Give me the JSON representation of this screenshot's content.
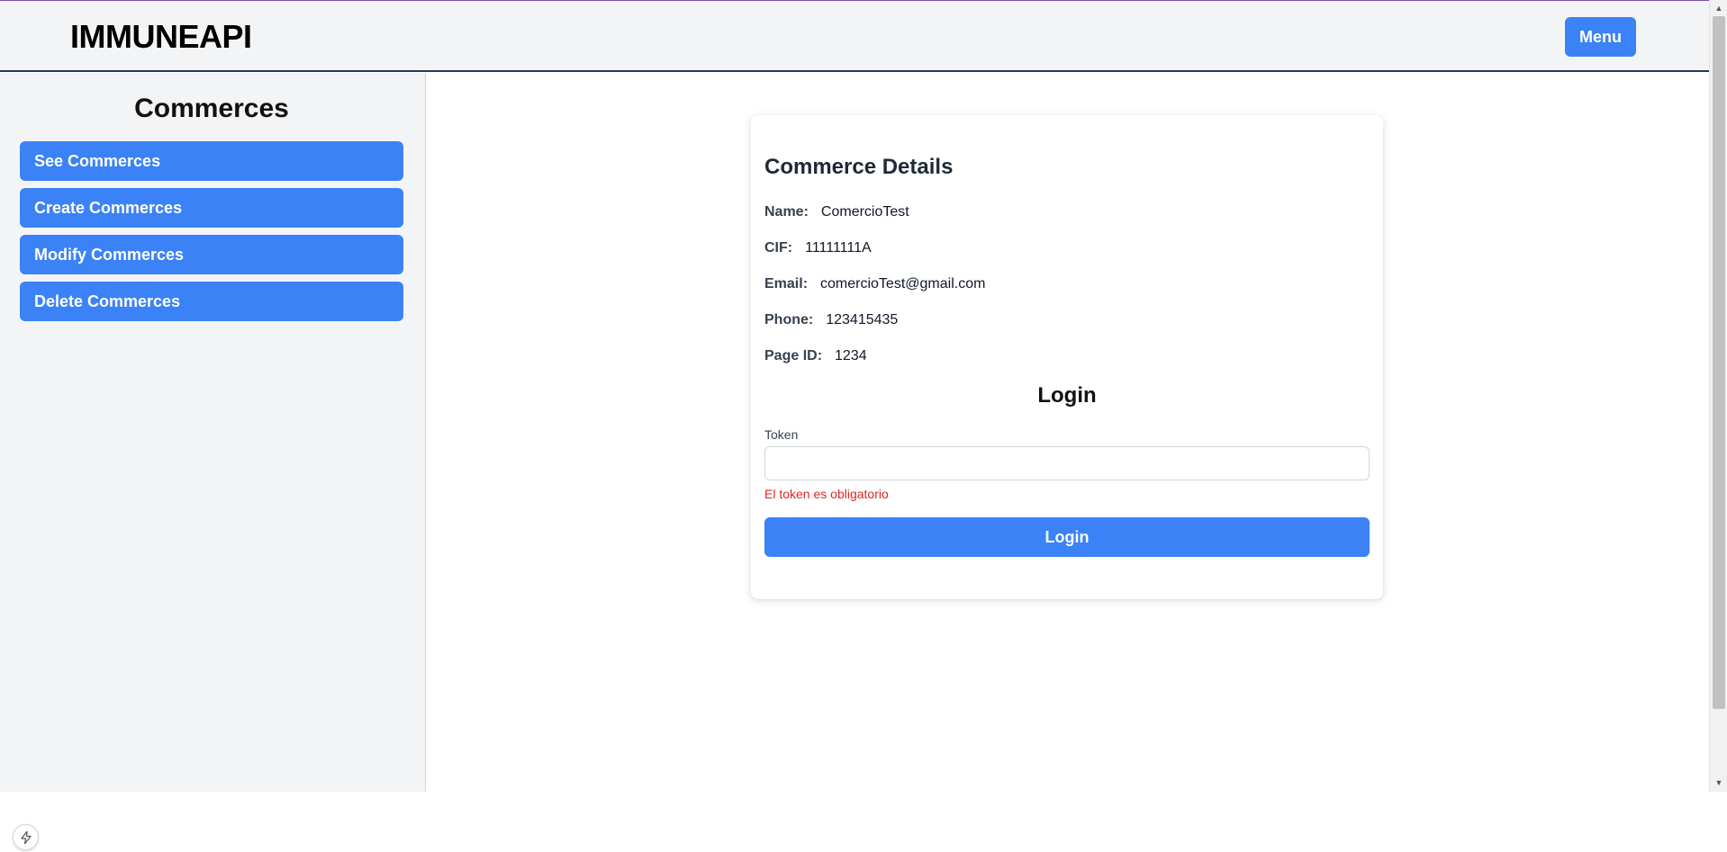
{
  "header": {
    "brand": "IMMUNEAPI",
    "menu_label": "Menu"
  },
  "sidebar": {
    "title": "Commerces",
    "items": [
      {
        "label": "See Commerces"
      },
      {
        "label": "Create Commerces"
      },
      {
        "label": "Modify Commerces"
      },
      {
        "label": "Delete Commerces"
      }
    ]
  },
  "details": {
    "title": "Commerce Details",
    "fields": [
      {
        "label": "Name:",
        "value": "ComercioTest"
      },
      {
        "label": "CIF:",
        "value": "11111111A"
      },
      {
        "label": "Email:",
        "value": "comercioTest@gmail.com"
      },
      {
        "label": "Phone:",
        "value": "123415435"
      },
      {
        "label": "Page ID:",
        "value": "1234"
      }
    ]
  },
  "login": {
    "title": "Login",
    "token_label": "Token",
    "token_value": "",
    "token_error": "El token es obligatorio",
    "button_label": "Login"
  },
  "icons": {
    "scroll_up": "scroll-up-arrow-icon",
    "scroll_down": "scroll-down-arrow-icon",
    "devtools": "lightning-bolt-icon"
  },
  "colors": {
    "accent": "#3b82f6",
    "error": "#dc2626",
    "sidebar_bg": "#f3f4f6",
    "header_border": "#1f3b57"
  }
}
